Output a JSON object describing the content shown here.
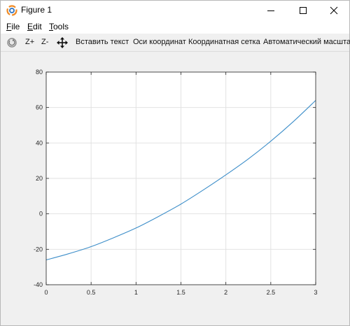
{
  "window": {
    "title": "Figure 1",
    "app_icon": "octave-logo-icon",
    "controls": {
      "minimize": "minimize-icon",
      "maximize": "maximize-icon",
      "close": "close-icon"
    }
  },
  "menu": [
    {
      "mnemonic": "F",
      "rest": "ile"
    },
    {
      "mnemonic": "E",
      "rest": "dit"
    },
    {
      "mnemonic": "T",
      "rest": "ools"
    }
  ],
  "toolbar": {
    "rotate_icon": "rotate-icon",
    "zoom_in": "Z+",
    "zoom_out": "Z-",
    "pan_icon": "pan-arrows-icon",
    "insert_text": "Вставить текст",
    "axes": "Оси координат",
    "grid": "Координатная сетка",
    "autoscale": "Автоматический масштаб"
  },
  "colors": {
    "line": "#3d8ec9",
    "grid": "#e2e2e2",
    "axes_bg": "#ffffff",
    "figure_bg": "#f0f0f0"
  },
  "chart_data": {
    "type": "line",
    "title": "",
    "xlabel": "",
    "ylabel": "",
    "xlim": [
      0,
      3
    ],
    "ylim": [
      -40,
      80
    ],
    "grid": true,
    "x_ticks": [
      0,
      0.5,
      1,
      1.5,
      2,
      2.5,
      3
    ],
    "x_tick_labels": [
      "0",
      "0.5",
      "1",
      "1.5",
      "2",
      "2.5",
      "3"
    ],
    "y_ticks": [
      -40,
      -20,
      0,
      20,
      40,
      60,
      80
    ],
    "y_tick_labels": [
      "-40",
      "-20",
      "0",
      "20",
      "40",
      "60",
      "80"
    ],
    "series": [
      {
        "x": [
          0,
          0.25,
          0.5,
          0.75,
          1,
          1.25,
          1.5,
          1.75,
          2,
          2.25,
          2.5,
          2.75,
          3
        ],
        "y": [
          -26,
          -22.5,
          -18.5,
          -13.5,
          -8,
          -1.5,
          5.5,
          13.5,
          22,
          31,
          41,
          52,
          64
        ]
      }
    ]
  }
}
